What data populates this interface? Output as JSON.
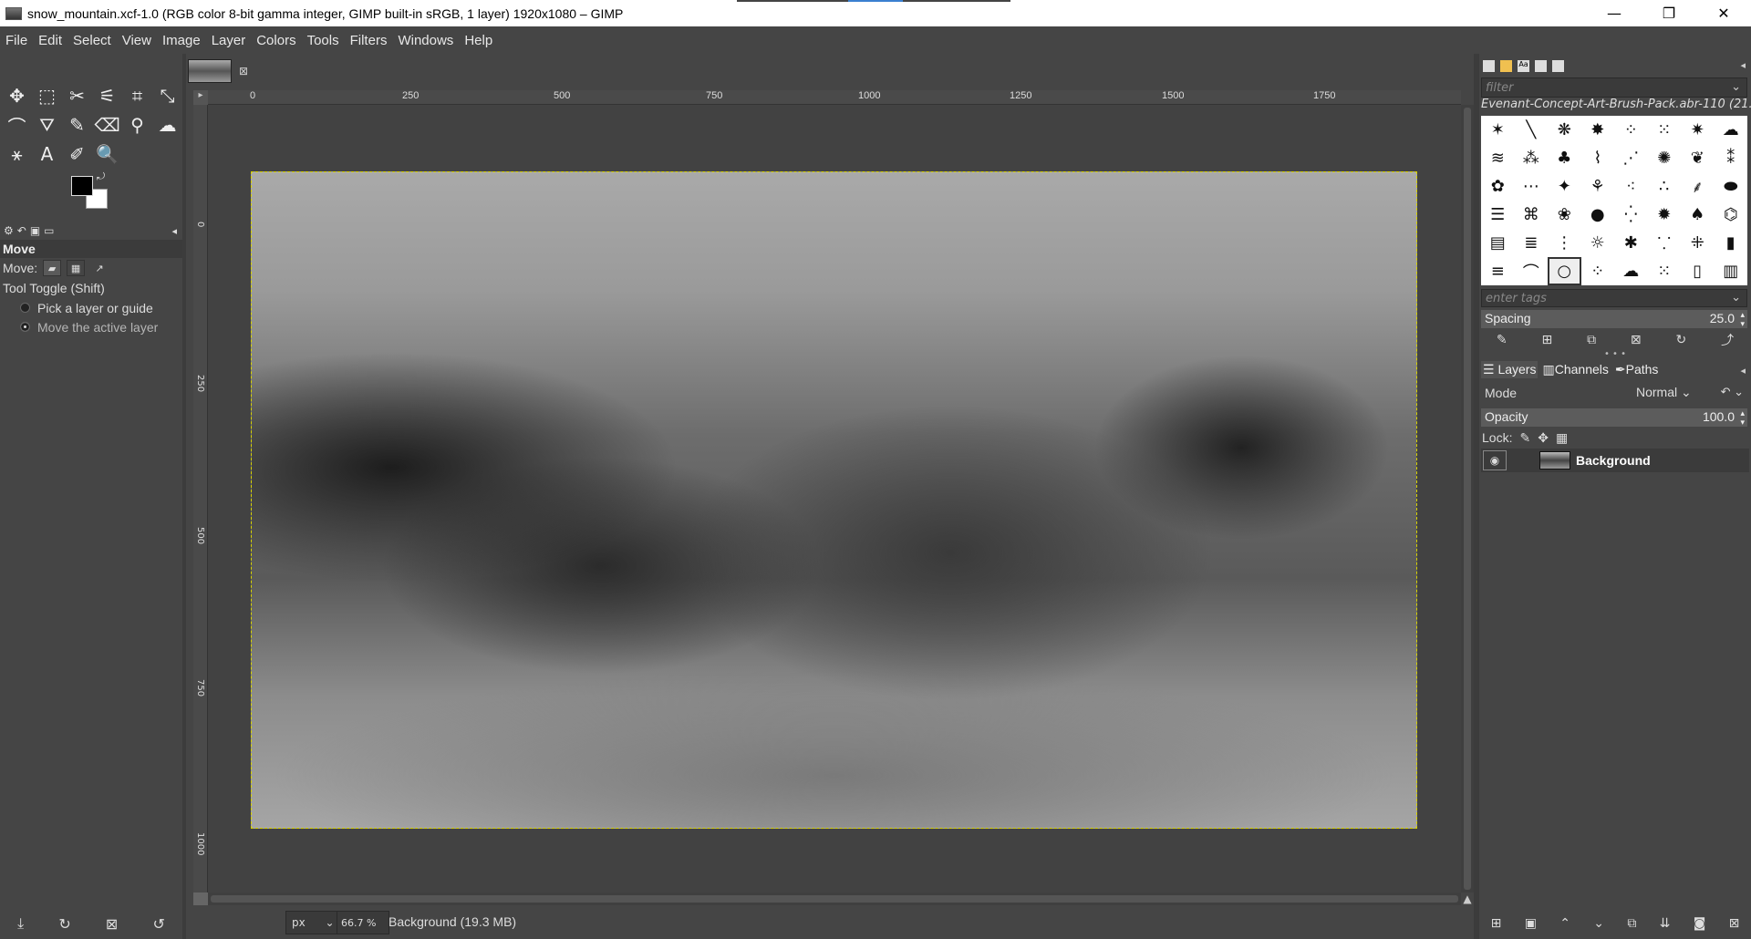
{
  "window": {
    "title": "snow_mountain.xcf-1.0 (RGB color 8-bit gamma integer, GIMP built-in sRGB, 1 layer) 1920x1080 – GIMP",
    "minimize": "—",
    "restore": "❐",
    "close": "✕"
  },
  "menu": [
    "File",
    "Edit",
    "Select",
    "View",
    "Image",
    "Layer",
    "Colors",
    "Tools",
    "Filters",
    "Windows",
    "Help"
  ],
  "toolbox": {
    "tools": [
      {
        "name": "move-tool-icon",
        "glyph": "✥"
      },
      {
        "name": "rect-select-icon",
        "glyph": "⬚"
      },
      {
        "name": "scissors-select-icon",
        "glyph": "✂"
      },
      {
        "name": "fuzzy-select-icon",
        "glyph": "⚟"
      },
      {
        "name": "crop-icon",
        "glyph": "⌗"
      },
      {
        "name": "transform-icon",
        "glyph": "⤡"
      },
      {
        "name": "warp-icon",
        "glyph": "⌒"
      },
      {
        "name": "bucket-fill-icon",
        "glyph": "⛛"
      },
      {
        "name": "paintbrush-icon",
        "glyph": "✎"
      },
      {
        "name": "eraser-icon",
        "glyph": "⌫"
      },
      {
        "name": "clone-icon",
        "glyph": "⚲"
      },
      {
        "name": "smudge-icon",
        "glyph": "☁"
      },
      {
        "name": "paths-icon",
        "glyph": "⚹"
      },
      {
        "name": "text-tool-icon",
        "glyph": "A"
      },
      {
        "name": "color-picker-icon",
        "glyph": "✐"
      },
      {
        "name": "zoom-icon",
        "glyph": "🔍"
      }
    ],
    "fg_color": "#000000",
    "bg_color": "#ffffff"
  },
  "tool_options": {
    "title": "Move",
    "move_label": "Move:",
    "toggle_label": "Tool Toggle  (Shift)",
    "option1": "Pick a layer or guide",
    "option2": "Move the active layer"
  },
  "image_window": {
    "ruler_h": [
      "0",
      "250",
      "500",
      "750",
      "1000",
      "1250",
      "1500",
      "1750"
    ],
    "ruler_v": [
      "0",
      "250",
      "500",
      "750",
      "1000"
    ],
    "unit": "px",
    "zoom": "66.7 %",
    "status": "Background (19.3 MB)"
  },
  "brushes": {
    "filter_placeholder": "filter",
    "brush_name": "Evenant-Concept-Art-Brush-Pack.abr-110 (21...",
    "tags_placeholder": "enter tags",
    "spacing_label": "Spacing",
    "spacing_value": "25.0"
  },
  "layers": {
    "tabs": [
      "Layers",
      "Channels",
      "Paths"
    ],
    "mode_label": "Mode",
    "mode_value": "Normal",
    "opacity_label": "Opacity",
    "opacity_value": "100.0",
    "lock_label": "Lock:",
    "layer_name": "Background"
  }
}
